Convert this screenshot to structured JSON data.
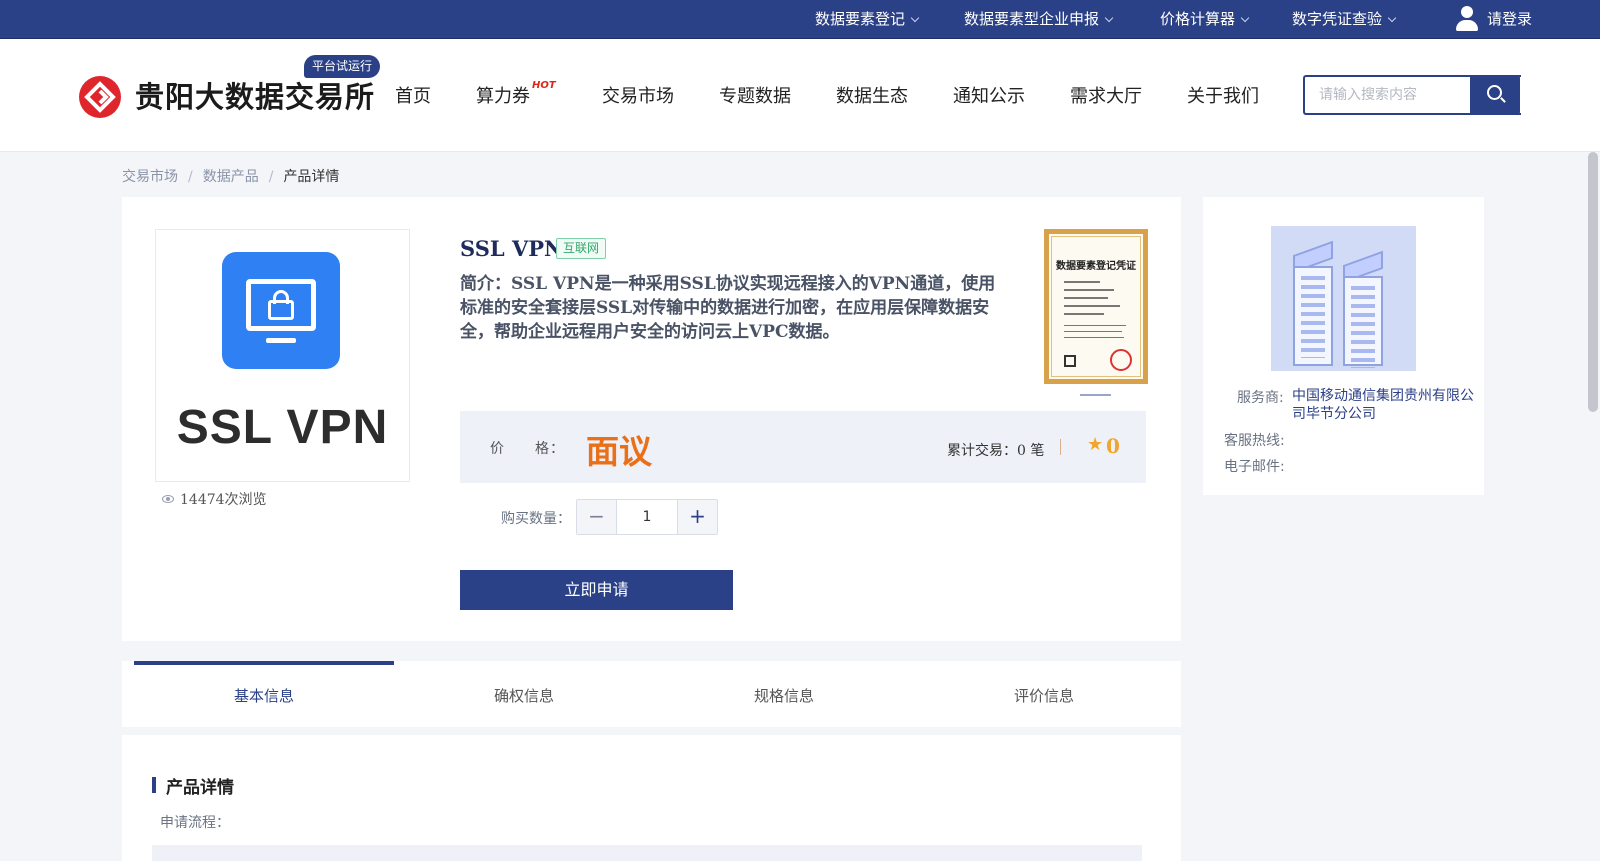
{
  "topbar": {
    "menus": [
      {
        "label": "数据要素登记"
      },
      {
        "label": "数据要素型企业申报"
      },
      {
        "label": "价格计算器"
      },
      {
        "label": "数字凭证查验"
      }
    ],
    "login_label": "请登录"
  },
  "header": {
    "logo_text": "贵阳大数据交易所",
    "trial_badge": "平台试运行",
    "nav": [
      {
        "label": "首页"
      },
      {
        "label": "算力券",
        "badge": "HOT"
      },
      {
        "label": "交易市场"
      },
      {
        "label": "专题数据"
      },
      {
        "label": "数据生态"
      },
      {
        "label": "通知公示"
      },
      {
        "label": "需求大厅"
      },
      {
        "label": "关于我们"
      }
    ],
    "search_placeholder": "请输入搜索内容"
  },
  "breadcrumb": [
    {
      "label": "交易市场"
    },
    {
      "label": "数据产品"
    },
    {
      "label": "产品详情"
    }
  ],
  "product": {
    "image_text": "SSL VPN",
    "views": "14474次浏览",
    "title": "SSL VPN",
    "tag": "互联网",
    "intro": "简介：SSL VPN是一种采用SSL协议实现远程接入的VPN通道，使用标准的安全套接层SSL对传输中的数据进行加密，在应用层保障数据安全，帮助企业远程用户安全的访问云上VPC数据。",
    "certificate_title": "数据要素登记凭证",
    "price_label": "价　　格：",
    "price_value": "面议",
    "trade_count": "累计交易：0 笔",
    "rating": "0",
    "quantity_label": "购买数量：",
    "quantity": "1",
    "apply_label": "立即申请"
  },
  "provider": {
    "service_label": "服务商:",
    "service_value": "中国移动通信集团贵州有限公司毕节分公司",
    "hotline_label": "客服热线:",
    "hotline_value": "",
    "email_label": "电子邮件:",
    "email_value": ""
  },
  "tabs": [
    {
      "label": "基本信息",
      "active": true
    },
    {
      "label": "确权信息",
      "active": false
    },
    {
      "label": "规格信息",
      "active": false
    },
    {
      "label": "评价信息",
      "active": false
    }
  ],
  "detail": {
    "title": "产品详情",
    "sub_label": "申请流程："
  },
  "colors": {
    "primary": "#2b4187",
    "price": "#e96f18",
    "rating": "#f0a52b",
    "tag_green": "#35a86c"
  }
}
